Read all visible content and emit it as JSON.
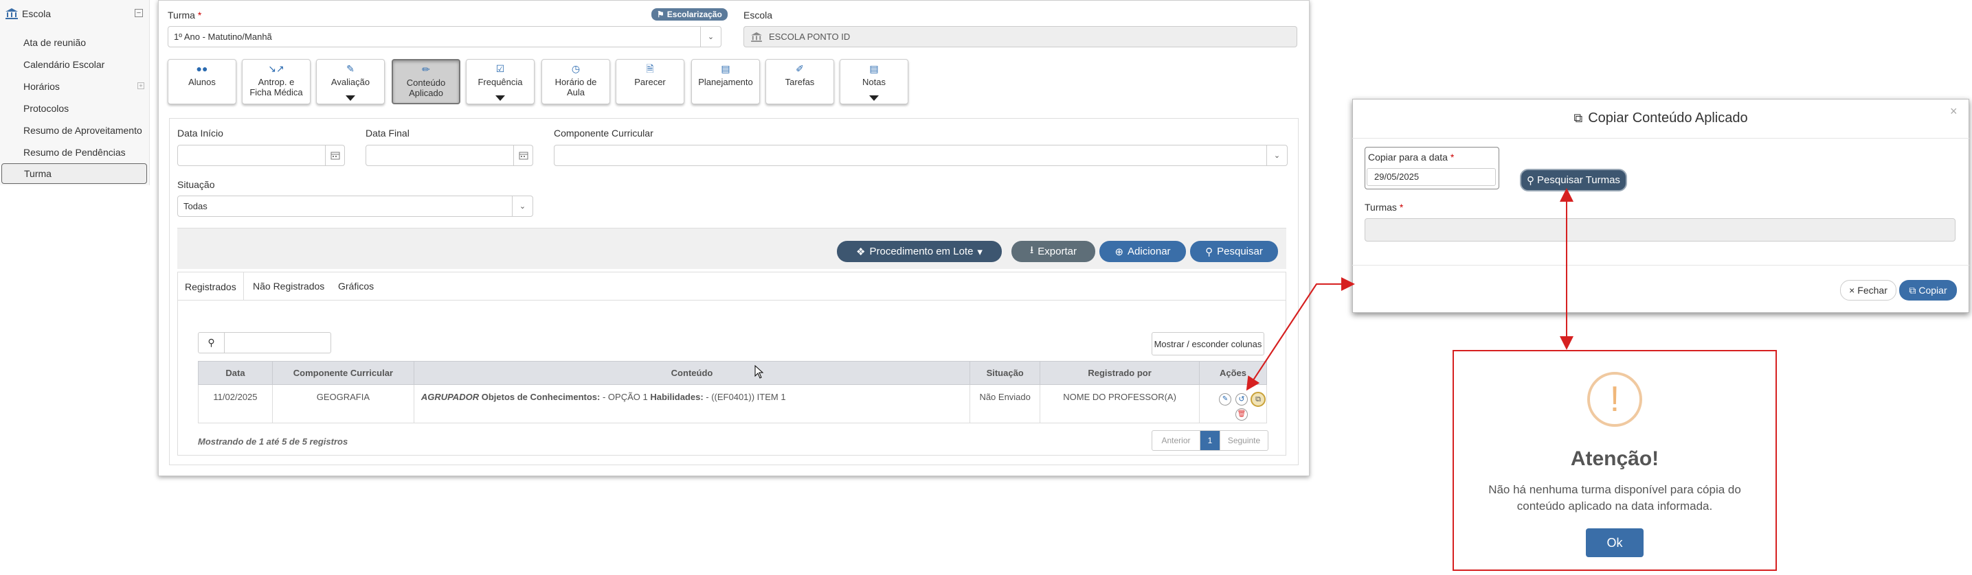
{
  "sidebar": {
    "header": "Escola",
    "items": [
      "Ata de reunião",
      "Calendário Escolar",
      "Horários",
      "Protocolos",
      "Resumo de Aproveitamento",
      "Resumo de Pendências",
      "Turma"
    ]
  },
  "form": {
    "turma_label": "Turma",
    "turma_value": "1º Ano - Matutino/Manhã",
    "badge": "Escolarização",
    "escola_label": "Escola",
    "escola_value": "ESCOLA PONTO ID"
  },
  "nav": [
    {
      "l1": "Alunos",
      "l2": ""
    },
    {
      "l1": "Antrop. e",
      "l2": "Ficha Médica"
    },
    {
      "l1": "Avaliação",
      "l2": ""
    },
    {
      "l1": "Conteúdo",
      "l2": "Aplicado"
    },
    {
      "l1": "Frequência",
      "l2": ""
    },
    {
      "l1": "Horário de",
      "l2": "Aula"
    },
    {
      "l1": "Parecer",
      "l2": ""
    },
    {
      "l1": "Planejamento",
      "l2": ""
    },
    {
      "l1": "Tarefas",
      "l2": ""
    },
    {
      "l1": "Notas",
      "l2": ""
    }
  ],
  "filters": {
    "data_inicio": "Data Início",
    "data_final": "Data Final",
    "componente": "Componente Curricular",
    "situacao": "Situação",
    "situacao_value": "Todas"
  },
  "actions": {
    "lote": "Procedimento em Lote",
    "exportar": "Exportar",
    "adicionar": "Adicionar",
    "pesquisar": "Pesquisar"
  },
  "tabs": [
    "Registrados",
    "Não Registrados",
    "Gráficos"
  ],
  "table": {
    "toggle_cols": "Mostrar / esconder colunas",
    "headers": [
      "Data",
      "Componente Curricular",
      "Conteúdo",
      "Situação",
      "Registrado por",
      "Ações"
    ],
    "row": {
      "data": "11/02/2025",
      "componente": "GEOGRAFIA",
      "agrupador": "AGRUPADOR",
      "obj_label": "Objetos de Conhecimentos:",
      "obj_value": "- OPÇÃO 1",
      "hab_label": "Habilidades:",
      "hab_value": "- ((EF0401)) ITEM 1",
      "situacao": "Não Enviado",
      "registrado": "NOME DO PROFESSOR(A)"
    },
    "footer": "Mostrando de 1 até 5 de 5 registros",
    "prev": "Anterior",
    "page": "1",
    "next": "Seguinte"
  },
  "modal": {
    "title": "Copiar Conteúdo Aplicado",
    "date_label": "Copiar para a data",
    "date_value": "29/05/2025",
    "search_btn": "Pesquisar Turmas",
    "turmas_label": "Turmas",
    "close_btn": "Fechar",
    "copy_btn": "Copiar"
  },
  "alert": {
    "icon": "!",
    "title": "Atenção!",
    "line1": "Não há nenhuma turma disponível para cópia do",
    "line2": "conteúdo aplicado na data informada.",
    "ok": "Ok"
  },
  "colors": {
    "primary": "#3a6ea8",
    "dark": "#3d5670",
    "annotation": "#d62020",
    "warning": "#f0b77a"
  }
}
